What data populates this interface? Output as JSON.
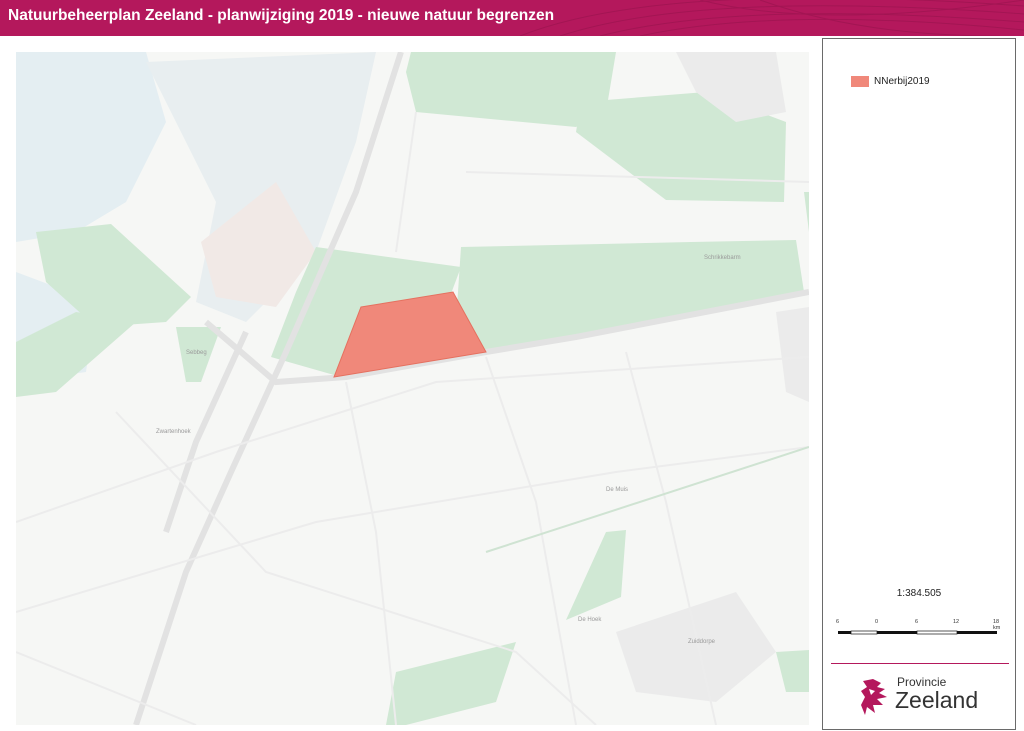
{
  "header": {
    "title": "Natuurbeheerplan Zeeland - planwijziging 2019 - nieuwe natuur begrenzen"
  },
  "colors": {
    "brand": "#b4185c",
    "polygon": "#f0887a",
    "nature": "#cfe7d3",
    "water": "#e1edf1"
  },
  "map": {
    "place_labels": [
      "Sebbeg",
      "Zwartenhoek",
      "De Muis",
      "De Hoek",
      "Zuiddorpe",
      "Schrikkebarm"
    ]
  },
  "legend": {
    "items": [
      {
        "label": "NNerbij2019",
        "color": "#f0887a"
      }
    ]
  },
  "scale": {
    "text": "1:384.505",
    "ticks": [
      "6",
      "0",
      "6",
      "12",
      "18 km"
    ]
  },
  "logo": {
    "line1": "Provincie",
    "line2": "Zeeland",
    "icon": "zeeland-lion-icon"
  }
}
